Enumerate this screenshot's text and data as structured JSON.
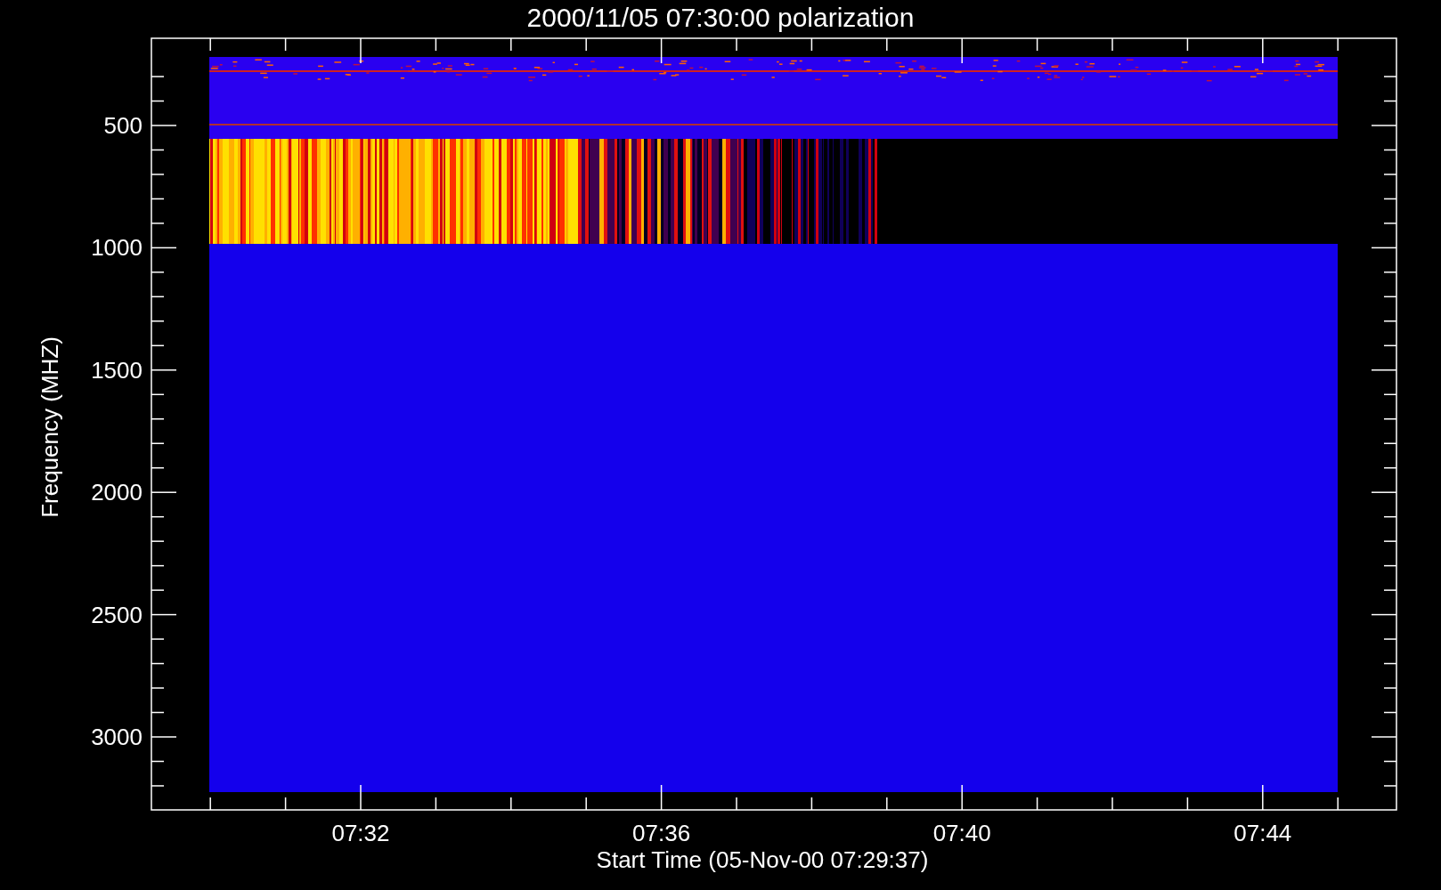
{
  "title": "2000/11/05 07:30:00 polarization",
  "y_axis": {
    "label": "Frequency (MHZ)",
    "tick_labels": [
      "500",
      "1000",
      "1500",
      "2000",
      "2500",
      "3000"
    ]
  },
  "x_axis": {
    "label": "Start Time (05-Nov-00 07:29:37)",
    "tick_labels": [
      "07:32",
      "07:36",
      "07:40",
      "07:44"
    ]
  }
}
